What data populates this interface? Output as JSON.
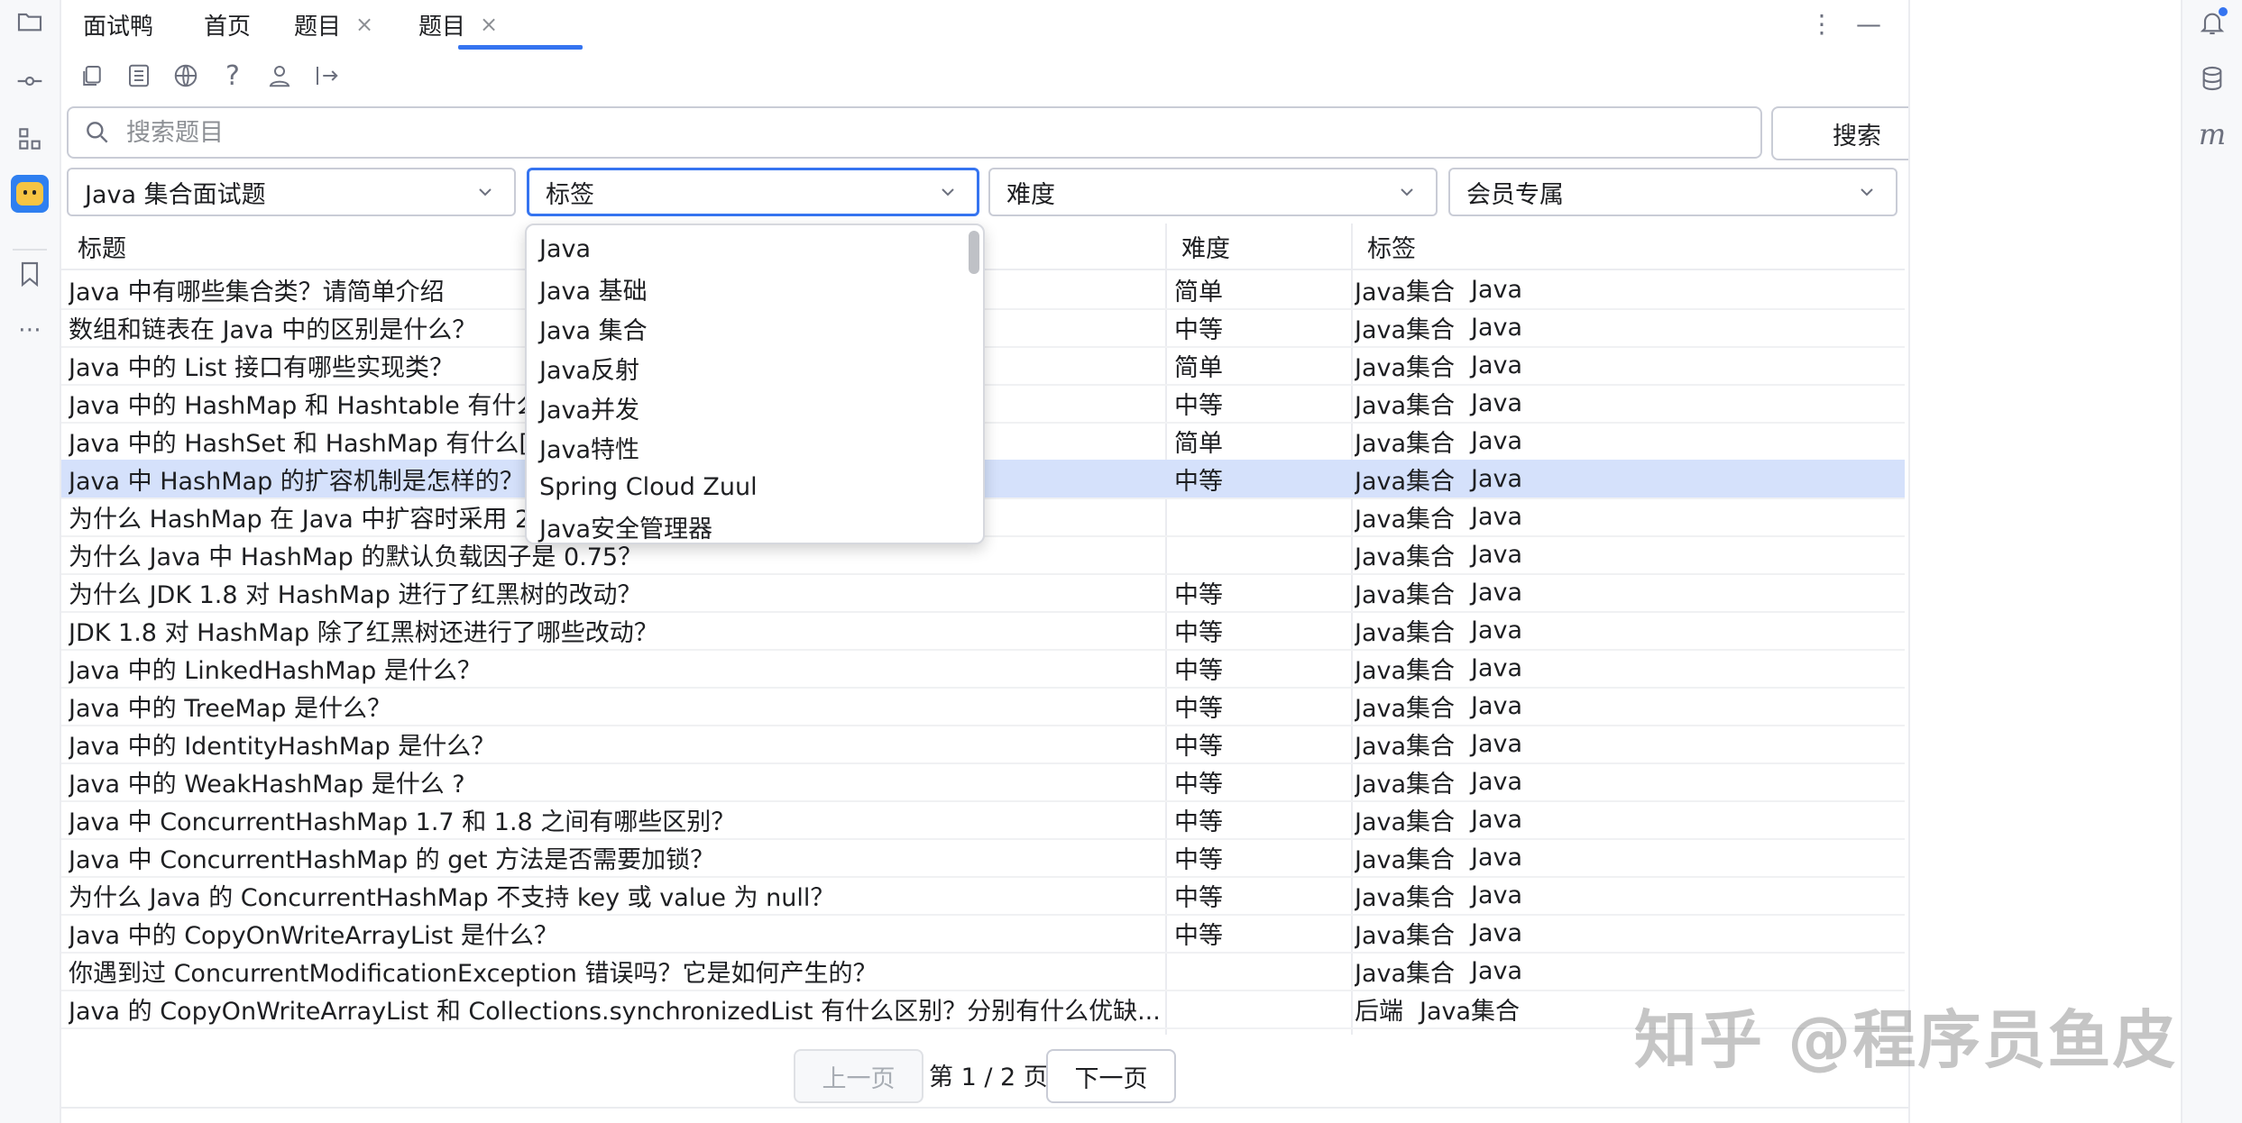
{
  "tabs": [
    {
      "label": "面试鸭"
    },
    {
      "label": "首页"
    },
    {
      "label": "题目",
      "closable": true
    },
    {
      "label": "题目",
      "closable": true,
      "active": true
    }
  ],
  "search": {
    "placeholder": "搜索题目",
    "value": "",
    "button_label": "搜索"
  },
  "filters": {
    "category": "Java 集合面试题",
    "tags": "标签",
    "difficulty": "难度",
    "membership": "会员专属"
  },
  "table": {
    "headers": [
      "标题",
      "难度",
      "标签"
    ],
    "rows": [
      {
        "title": "Java 中有哪些集合类？请简单介绍",
        "difficulty": "简单",
        "tags": [
          "Java集合",
          "Java"
        ]
      },
      {
        "title": "数组和链表在 Java 中的区别是什么？",
        "difficulty": "中等",
        "tags": [
          "Java集合",
          "Java"
        ]
      },
      {
        "title": "Java 中的 List 接口有哪些实现类？",
        "difficulty": "简单",
        "tags": [
          "Java集合",
          "Java"
        ]
      },
      {
        "title": "Java 中的 HashMap 和 Hashtable 有什么",
        "difficulty": "中等",
        "tags": [
          "Java集合",
          "Java"
        ]
      },
      {
        "title": "Java 中的 HashSet 和 HashMap 有什么[",
        "difficulty": "简单",
        "tags": [
          "Java集合",
          "Java"
        ]
      },
      {
        "title": "Java 中 HashMap 的扩容机制是怎样的？",
        "difficulty": "中等",
        "tags": [
          "Java集合",
          "Java"
        ],
        "selected": true
      },
      {
        "title": "为什么 HashMap 在 Java 中扩容时采用 2",
        "difficulty": "",
        "tags": [
          "Java集合",
          "Java"
        ]
      },
      {
        "title": "为什么 Java 中 HashMap 的默认负载因子是 0.75？",
        "difficulty": "",
        "tags": [
          "Java集合",
          "Java"
        ]
      },
      {
        "title": "为什么 JDK 1.8 对 HashMap 进行了红黑树的改动？",
        "difficulty": "中等",
        "tags": [
          "Java集合",
          "Java"
        ]
      },
      {
        "title": "JDK 1.8 对 HashMap 除了红黑树还进行了哪些改动？",
        "difficulty": "中等",
        "tags": [
          "Java集合",
          "Java"
        ]
      },
      {
        "title": "Java 中的 LinkedHashMap 是什么？",
        "difficulty": "中等",
        "tags": [
          "Java集合",
          "Java"
        ]
      },
      {
        "title": "Java 中的 TreeMap 是什么？",
        "difficulty": "中等",
        "tags": [
          "Java集合",
          "Java"
        ]
      },
      {
        "title": "Java 中的 IdentityHashMap 是什么？",
        "difficulty": "中等",
        "tags": [
          "Java集合",
          "Java"
        ]
      },
      {
        "title": "Java 中的 WeakHashMap 是什么 ?",
        "difficulty": "中等",
        "tags": [
          "Java集合",
          "Java"
        ]
      },
      {
        "title": "Java 中 ConcurrentHashMap 1.7 和 1.8 之间有哪些区别？",
        "difficulty": "中等",
        "tags": [
          "Java集合",
          "Java"
        ]
      },
      {
        "title": "Java 中 ConcurrentHashMap 的 get 方法是否需要加锁？",
        "difficulty": "中等",
        "tags": [
          "Java集合",
          "Java"
        ]
      },
      {
        "title": "为什么 Java 的 ConcurrentHashMap 不支持 key 或 value 为 null？",
        "difficulty": "中等",
        "tags": [
          "Java集合",
          "Java"
        ]
      },
      {
        "title": "Java 中的 CopyOnWriteArrayList 是什么？",
        "difficulty": "中等",
        "tags": [
          "Java集合",
          "Java"
        ]
      },
      {
        "title": "你遇到过 ConcurrentModificationException 错误吗？它是如何产生的？",
        "difficulty": "",
        "tags": [
          "Java集合",
          "Java"
        ]
      },
      {
        "title": "Java 的 CopyOnWriteArrayList 和 Collections.synchronizedList 有什么区别？分别有什么优缺...",
        "difficulty": "",
        "tags": [
          "后端",
          "Java集合"
        ]
      }
    ]
  },
  "tag_dropdown": {
    "options": [
      "Java",
      "Java 基础",
      "Java 集合",
      "Java反射",
      "Java并发",
      "Java特性",
      "Spring Cloud Zuul",
      "Java安全管理器"
    ]
  },
  "pagination": {
    "prev_label": "上一页",
    "page_text": "第 1 / 2 页",
    "next_label": "下一页",
    "current_page": 1,
    "total_pages": 2
  },
  "watermark": "知乎 @程序员鱼皮",
  "right_sidebar": {
    "m_label": "m"
  },
  "icons": {
    "left": [
      "folder-icon",
      "commit-icon",
      "structure-icon",
      "duck-app-icon",
      "bookmark-icon",
      "more-icon"
    ],
    "toolbar": [
      "copy-icon",
      "list-icon",
      "globe-icon",
      "help-icon",
      "user-icon",
      "logout-icon"
    ],
    "right": [
      "notification-icon",
      "database-icon"
    ]
  },
  "colors": {
    "accent": "#3574f0",
    "selected_row": "#d5e1fb",
    "app_icon_bg": "#2f7ff0",
    "duck_yellow": "#f6c443"
  }
}
